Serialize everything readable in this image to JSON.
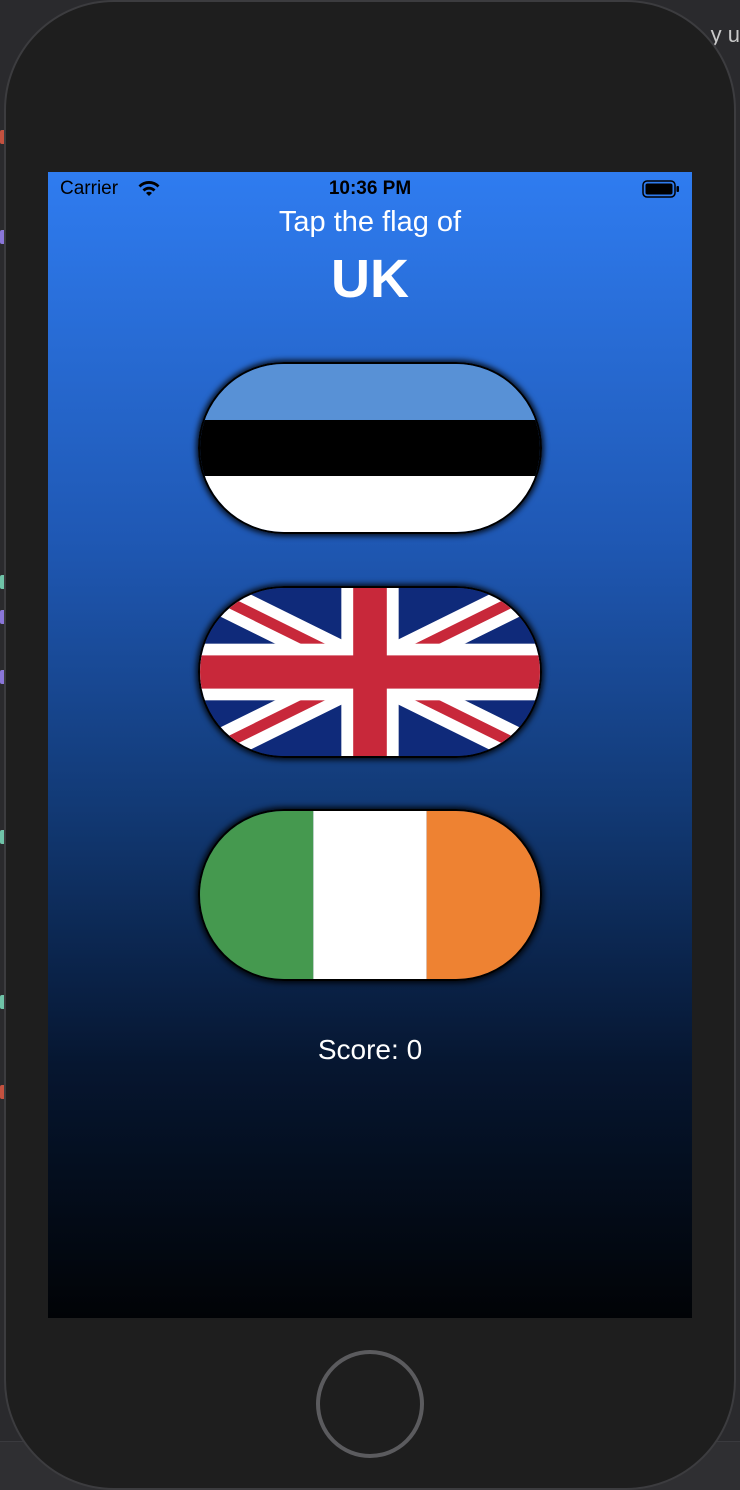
{
  "ide": {
    "corner_text": "y u"
  },
  "status_bar": {
    "carrier": "Carrier",
    "time": "10:36 PM"
  },
  "game": {
    "prompt": "Tap the flag of",
    "country": "UK",
    "score_label": "Score: 0"
  },
  "flags": [
    {
      "name": "Estonia",
      "colors": [
        "#5891d6",
        "#000000",
        "#ffffff"
      ]
    },
    {
      "name": "UK",
      "colors": [
        "#0f2a7a",
        "#ffffff",
        "#c8283a"
      ]
    },
    {
      "name": "Ireland",
      "colors": [
        "#45994f",
        "#ffffff",
        "#ee8232"
      ]
    }
  ],
  "icons": {
    "wifi": "wifi-icon",
    "battery": "battery-icon",
    "home": "home-button"
  }
}
